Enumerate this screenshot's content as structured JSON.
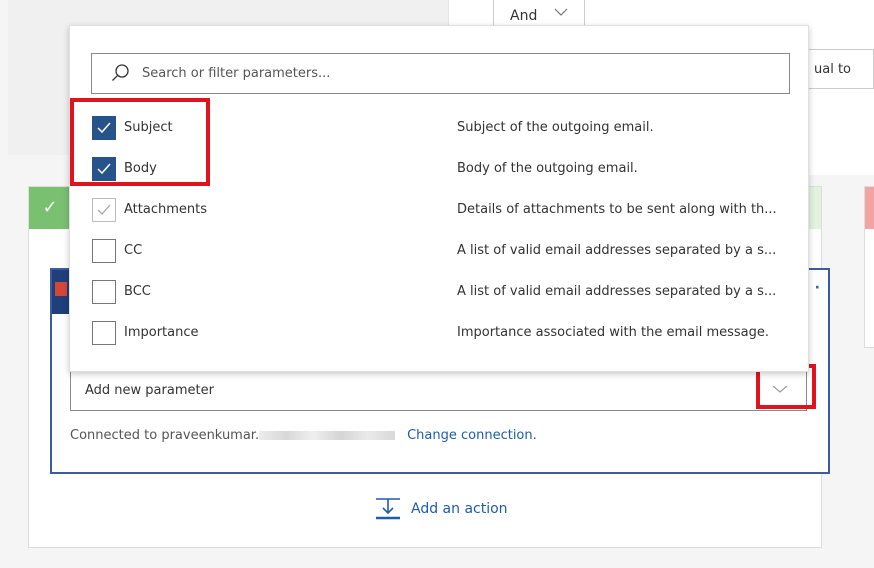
{
  "condition": {
    "operator": "And",
    "comparison": "ual to"
  },
  "popup": {
    "search_placeholder": "Search or filter parameters...",
    "items": [
      {
        "label": "Subject",
        "description": "Subject of the outgoing email.",
        "state": "checked"
      },
      {
        "label": "Body",
        "description": "Body of the outgoing email.",
        "state": "checked"
      },
      {
        "label": "Attachments",
        "description": "Details of attachments to be sent along with th...",
        "state": "checked-disabled"
      },
      {
        "label": "CC",
        "description": "A list of valid email addresses separated by a s...",
        "state": "unchecked"
      },
      {
        "label": "BCC",
        "description": "A list of valid email addresses separated by a s...",
        "state": "unchecked"
      },
      {
        "label": "Importance",
        "description": "Importance associated with the email message.",
        "state": "unchecked"
      }
    ]
  },
  "action": {
    "more_label": "·",
    "add_parameter_placeholder": "Add new parameter",
    "connected_prefix": "Connected to praveenkumar.",
    "change_connection": "Change connection.",
    "add_action": "Add an action"
  },
  "colors": {
    "checkbox_checked": "#26548a",
    "link": "#1f5ca8",
    "highlight": "#e0141e",
    "yes_branch": "#79c070",
    "no_branch": "#f4a3a3"
  }
}
